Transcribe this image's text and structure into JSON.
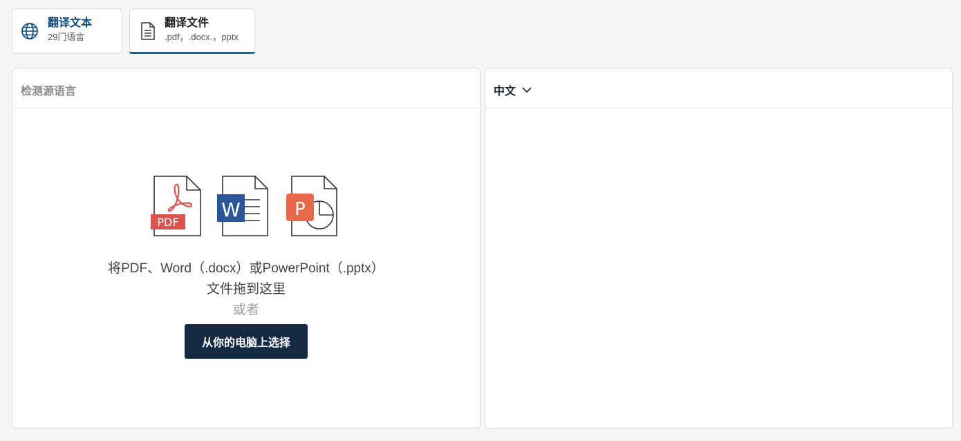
{
  "tabs": [
    {
      "title": "翻译文本",
      "subtitle": "29门语言",
      "icon": "globe-icon",
      "active": false
    },
    {
      "title": "翻译文件",
      "subtitle": ".pdf，.docx.，pptx",
      "icon": "document-icon",
      "active": true
    }
  ],
  "source_panel": {
    "language": "检测源语言",
    "file_icons": [
      {
        "name": "pdf-file-icon",
        "badge": "PDF",
        "color": "#d9534f"
      },
      {
        "name": "word-file-icon",
        "badge": "W",
        "color": "#2b579a"
      },
      {
        "name": "powerpoint-file-icon",
        "badge": "P",
        "color": "#e8684a"
      }
    ],
    "drop_line_1": "将PDF、Word（.docx）或PowerPoint（.pptx）",
    "drop_line_2": "文件拖到这里",
    "or_text": "或者",
    "select_button": "从你的电脑上选择"
  },
  "target_panel": {
    "language": "中文"
  },
  "colors": {
    "accent": "#0f6aa8",
    "button_bg": "#142a42",
    "pdf_red": "#d9534f",
    "word_blue": "#2b579a",
    "ppt_orange": "#e8684a"
  }
}
